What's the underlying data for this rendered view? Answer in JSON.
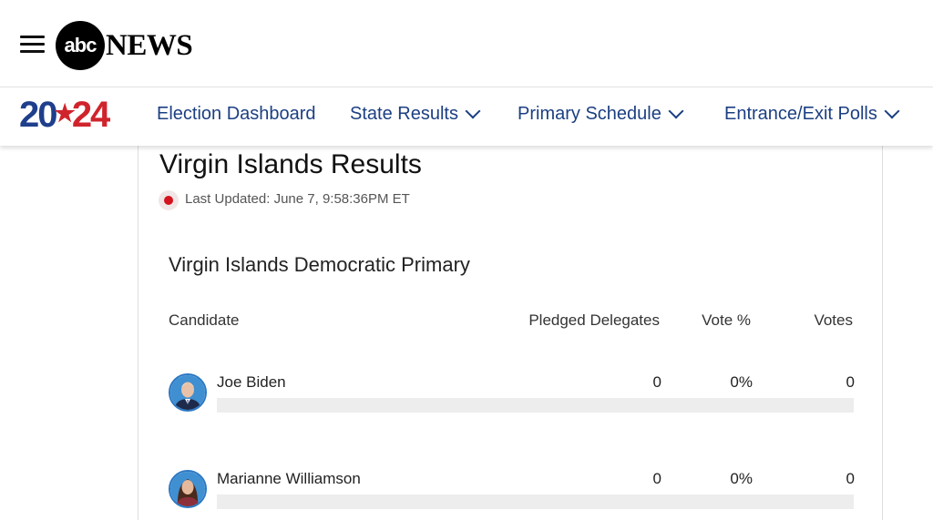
{
  "header": {
    "logo_abc": "abc",
    "logo_news": "NEWS"
  },
  "election_nav": {
    "year_left": "20",
    "year_right": "24",
    "items": [
      {
        "label": "Election Dashboard",
        "has_dropdown": false
      },
      {
        "label": "State Results",
        "has_dropdown": true
      },
      {
        "label": "Primary Schedule",
        "has_dropdown": true
      },
      {
        "label": "Entrance/Exit Polls",
        "has_dropdown": true
      }
    ]
  },
  "results": {
    "title": "Virgin Islands Results",
    "last_updated": "Last Updated: June 7, 9:58:36PM ET",
    "race_title": "Virgin Islands Democratic Primary",
    "columns": {
      "candidate": "Candidate",
      "delegates": "Pledged Delegates",
      "vote_pct": "Vote %",
      "votes": "Votes"
    },
    "candidates": [
      {
        "name": "Joe Biden",
        "delegates": "0",
        "vote_pct": "0%",
        "votes": "0",
        "bar_fraction": 0
      },
      {
        "name": "Marianne Williamson",
        "delegates": "0",
        "vote_pct": "0%",
        "votes": "0",
        "bar_fraction": 0
      }
    ]
  },
  "colors": {
    "nav_text": "#1c3f82",
    "live_dot": "#d4131e",
    "year_blue": "#1f3f8c",
    "year_red": "#d0242d"
  }
}
